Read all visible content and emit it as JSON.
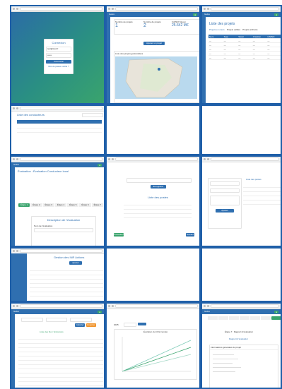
{
  "login": {
    "heading": "Connexion",
    "email_value": "test@test.fr",
    "password_value": "••••••",
    "submit_label": "Connexion",
    "link_label": "Mot de passe oublié ?"
  },
  "dashboard": {
    "stat1_label": "Nombre de projets",
    "stat1_value": "1",
    "stat2_label": "Nombre de projets",
    "stat2_value": "2",
    "stat3_label": "CAPEX Moyen",
    "stat3_value": "25.642 M€",
    "button_label": "Ajouter un projet",
    "map_title": "Liste des projets géolocalisés"
  },
  "projects": {
    "title": "Liste des projets",
    "tabs": [
      "Projets en cours",
      "Projets validés",
      "Projets archivés"
    ],
    "headers": [
      "Nom",
      "Type",
      "Statut",
      "Création",
      "CAPEX"
    ]
  },
  "users": {
    "title": "Liste des conducteurs",
    "search_placeholder": "Rechercher"
  },
  "evaluation": {
    "title": "Évaluation : Évaluation Conducteur local",
    "steps": [
      "Étape 1",
      "Étape 2",
      "Étape 3",
      "Étape 4",
      "Étape 5",
      "Étape 6",
      "Étape 7"
    ],
    "section_title": "Description de l'évaluation",
    "field_label": "Nom de l'évaluation"
  },
  "form": {
    "table_title": "Liste des postes",
    "save_label": "Enregistrer",
    "prev_label": "Précédent",
    "next_label": "Suivant"
  },
  "side": {
    "title": "Liste des postes",
    "button_label": "Ajouter"
  },
  "admin": {
    "title": "Gestion des INR Actions",
    "button_label": "Ajouter"
  },
  "results": {
    "table_title": "Liste des flux / Emissions",
    "btn1": "Calculer",
    "btn2": "Exporter"
  },
  "chart_panel": {
    "chart_title": "Évolution du CO2 cumulé",
    "year_label": "2025"
  },
  "report": {
    "step_title": "Étape 7 : Rapport d'évaluation",
    "report_title": "Rapport d'évaluation",
    "section": "Informations générales du projet"
  }
}
